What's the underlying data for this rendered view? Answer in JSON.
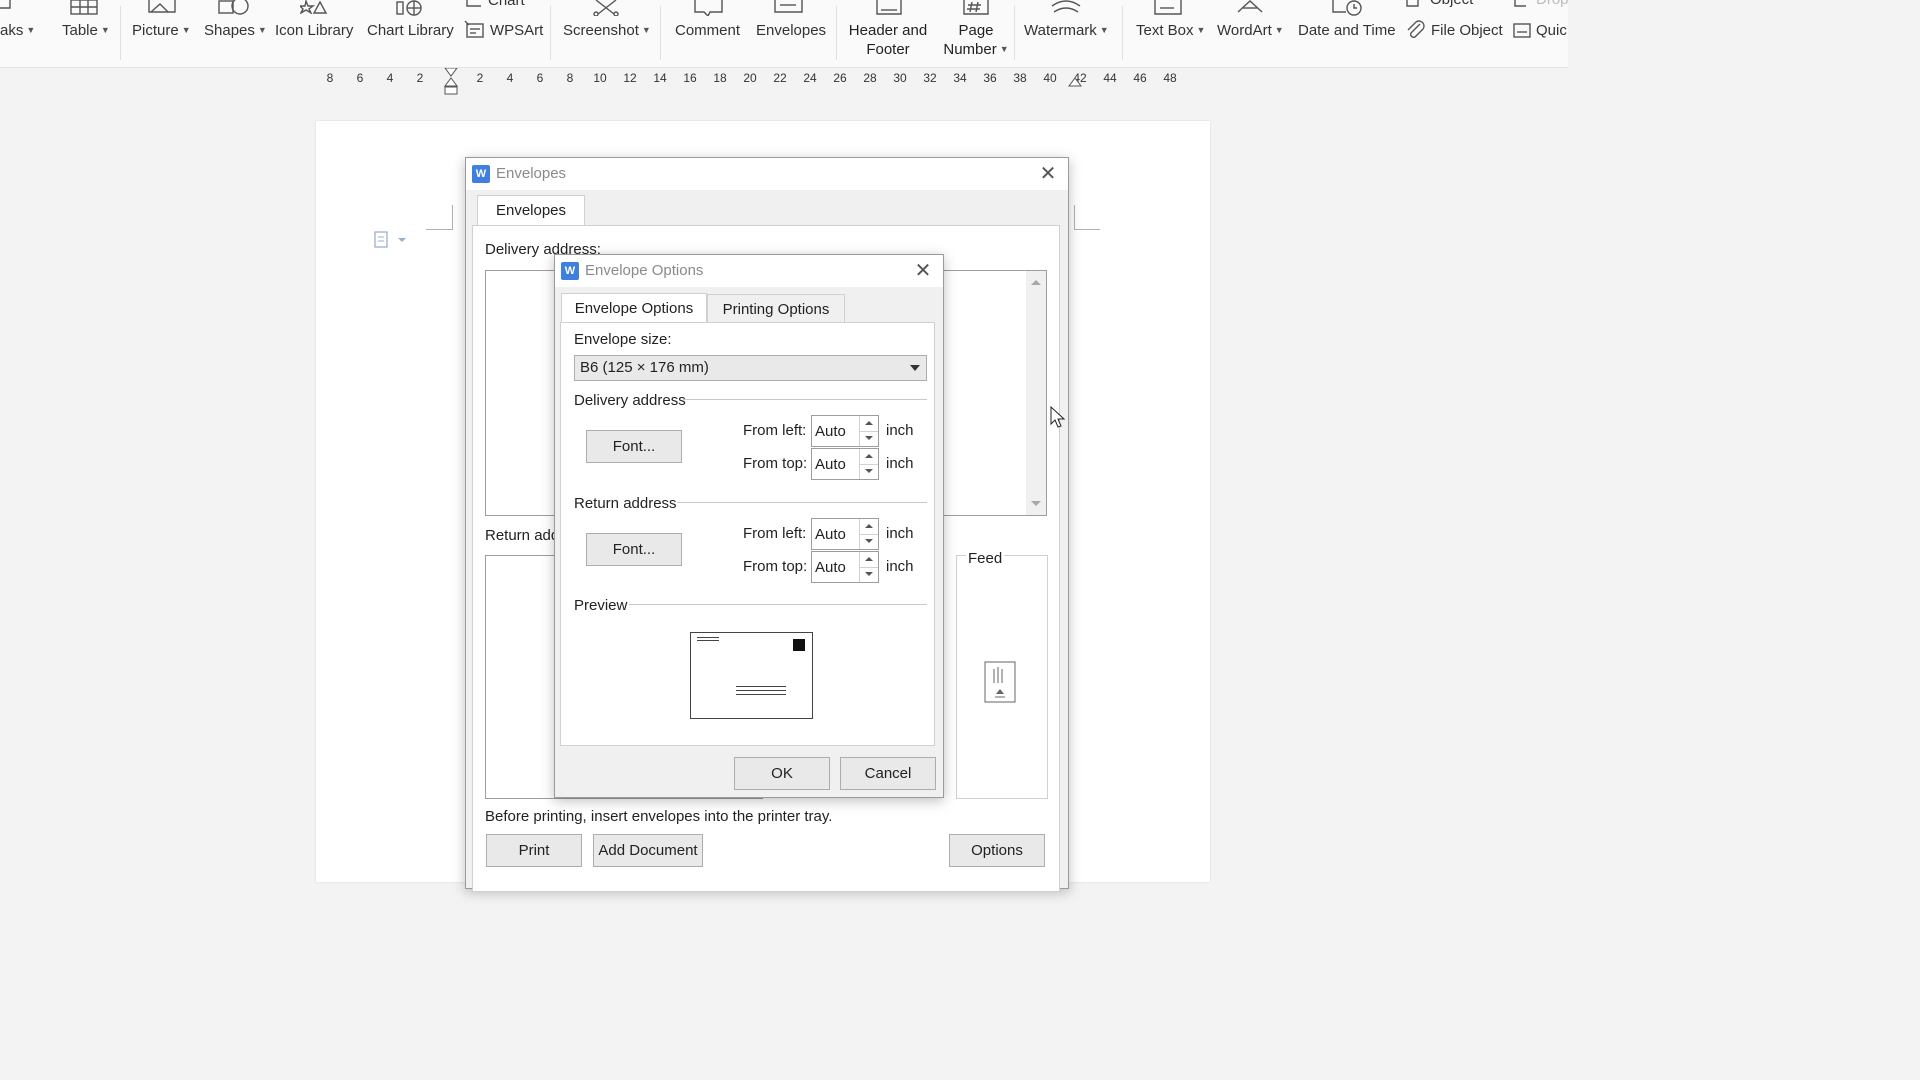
{
  "ribbon": {
    "items": {
      "breaks": "aks",
      "table": "Table",
      "picture": "Picture",
      "shapes": "Shapes",
      "icon_library": "Icon Library",
      "chart_library": "Chart Library",
      "chart": "Chart",
      "wpsart": "WPSArt",
      "screenshot": "Screenshot",
      "comment": "Comment",
      "envelopes": "Envelopes",
      "header_footer_1": "Header and",
      "header_footer_2": "Footer",
      "page_number_1": "Page",
      "page_number_2": "Number",
      "watermark": "Watermark",
      "text_box": "Text Box",
      "wordart": "WordArt",
      "date_time": "Date and Time",
      "object": "Object",
      "file_object": "File Object",
      "quick": "Quic",
      "drop": "Drop"
    }
  },
  "ruler": {
    "left_numbers": [
      "8",
      "6",
      "4",
      "2"
    ],
    "right_numbers": [
      "2",
      "4",
      "6",
      "8",
      "10",
      "12",
      "14",
      "16",
      "18",
      "20",
      "22",
      "24",
      "26",
      "28",
      "30",
      "32",
      "34",
      "36",
      "38",
      "40",
      "42",
      "44",
      "46",
      "48"
    ]
  },
  "envelopes_dialog": {
    "title": "Envelopes",
    "logo": "W",
    "tab": "Envelopes",
    "delivery_address_label": "Delivery address:",
    "return_address_label": "Return add",
    "feed_label": "Feed",
    "note": "Before printing, insert envelopes into the printer tray.",
    "print_button": "Print",
    "add_document_button": "Add Document",
    "options_button": "Options"
  },
  "options_dialog": {
    "title": "Envelope Options",
    "logo": "W",
    "tabs": [
      "Envelope Options",
      "Printing Options"
    ],
    "envelope_size_label": "Envelope size:",
    "envelope_size_value": "B6 (125 × 176 mm)",
    "delivery_section": "Delivery address",
    "return_section": "Return address",
    "preview_section": "Preview",
    "font_button": "Font...",
    "from_left_label": "From left:",
    "from_top_label": "From top:",
    "unit": "inch",
    "delivery_from_left": "Auto",
    "delivery_from_top": "Auto",
    "return_from_left": "Auto",
    "return_from_top": "Auto",
    "ok_button": "OK",
    "cancel_button": "Cancel"
  }
}
